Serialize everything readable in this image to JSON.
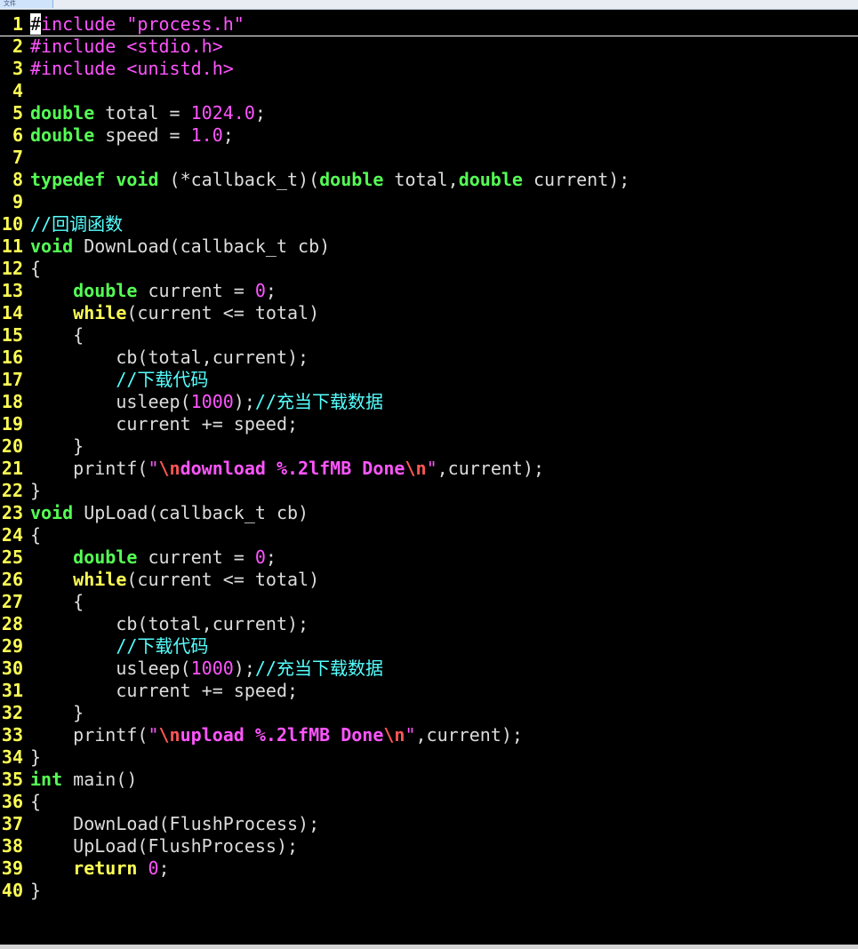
{
  "window": {
    "tab_label": "文件"
  },
  "editor": {
    "lines": [
      {
        "n": "1",
        "tokens": [
          {
            "t": "#",
            "c": "cursor"
          },
          {
            "t": "include ",
            "c": "pre"
          },
          {
            "t": "\"process.h\"",
            "c": "str"
          }
        ]
      },
      {
        "n": "2",
        "tokens": [
          {
            "t": "#include ",
            "c": "pre"
          },
          {
            "t": "<stdio.h>",
            "c": "str"
          }
        ]
      },
      {
        "n": "3",
        "tokens": [
          {
            "t": "#include ",
            "c": "pre"
          },
          {
            "t": "<unistd.h>",
            "c": "str"
          }
        ]
      },
      {
        "n": "4",
        "tokens": []
      },
      {
        "n": "5",
        "tokens": [
          {
            "t": "double",
            "c": "type"
          },
          {
            "t": " total = ",
            "c": "plain"
          },
          {
            "t": "1024.0",
            "c": "num"
          },
          {
            "t": ";",
            "c": "plain"
          }
        ]
      },
      {
        "n": "6",
        "tokens": [
          {
            "t": "double",
            "c": "type"
          },
          {
            "t": " speed = ",
            "c": "plain"
          },
          {
            "t": "1.0",
            "c": "num"
          },
          {
            "t": ";",
            "c": "plain"
          }
        ]
      },
      {
        "n": "7",
        "tokens": []
      },
      {
        "n": "8",
        "tokens": [
          {
            "t": "typedef",
            "c": "type"
          },
          {
            "t": " ",
            "c": "plain"
          },
          {
            "t": "void",
            "c": "type"
          },
          {
            "t": " (*callback_t)(",
            "c": "plain"
          },
          {
            "t": "double",
            "c": "type"
          },
          {
            "t": " total,",
            "c": "plain"
          },
          {
            "t": "double",
            "c": "type"
          },
          {
            "t": " current);",
            "c": "plain"
          }
        ]
      },
      {
        "n": "9",
        "tokens": []
      },
      {
        "n": "10",
        "tokens": [
          {
            "t": "//回调函数",
            "c": "cmt"
          }
        ]
      },
      {
        "n": "11",
        "tokens": [
          {
            "t": "void",
            "c": "type"
          },
          {
            "t": " DownLoad(callback_t cb)",
            "c": "plain"
          }
        ]
      },
      {
        "n": "12",
        "tokens": [
          {
            "t": "{",
            "c": "plain"
          }
        ]
      },
      {
        "n": "13",
        "tokens": [
          {
            "t": "    ",
            "c": "plain"
          },
          {
            "t": "double",
            "c": "type"
          },
          {
            "t": " current = ",
            "c": "plain"
          },
          {
            "t": "0",
            "c": "num"
          },
          {
            "t": ";",
            "c": "plain"
          }
        ]
      },
      {
        "n": "14",
        "tokens": [
          {
            "t": "    ",
            "c": "plain"
          },
          {
            "t": "while",
            "c": "stmt"
          },
          {
            "t": "(current <= total)",
            "c": "plain"
          }
        ]
      },
      {
        "n": "15",
        "tokens": [
          {
            "t": "    {",
            "c": "plain"
          }
        ]
      },
      {
        "n": "16",
        "tokens": [
          {
            "t": "        cb(total,current);",
            "c": "plain"
          }
        ]
      },
      {
        "n": "17",
        "tokens": [
          {
            "t": "        ",
            "c": "plain"
          },
          {
            "t": "//下载代码",
            "c": "cmt"
          }
        ]
      },
      {
        "n": "18",
        "tokens": [
          {
            "t": "        usleep(",
            "c": "plain"
          },
          {
            "t": "1000",
            "c": "num"
          },
          {
            "t": ");",
            "c": "plain"
          },
          {
            "t": "//充当下载数据",
            "c": "cmt"
          }
        ]
      },
      {
        "n": "19",
        "tokens": [
          {
            "t": "        current += speed;",
            "c": "plain"
          }
        ]
      },
      {
        "n": "20",
        "tokens": [
          {
            "t": "    }",
            "c": "plain"
          }
        ]
      },
      {
        "n": "21",
        "tokens": [
          {
            "t": "    printf(",
            "c": "plain"
          },
          {
            "t": "\"",
            "c": "str"
          },
          {
            "t": "\\n",
            "c": "esc"
          },
          {
            "t": "download %.2lfMB Done",
            "c": "strb"
          },
          {
            "t": "\\n",
            "c": "esc"
          },
          {
            "t": "\"",
            "c": "str"
          },
          {
            "t": ",current);",
            "c": "plain"
          }
        ]
      },
      {
        "n": "22",
        "tokens": [
          {
            "t": "}",
            "c": "plain"
          }
        ]
      },
      {
        "n": "23",
        "tokens": [
          {
            "t": "void",
            "c": "type"
          },
          {
            "t": " UpLoad(callback_t cb)",
            "c": "plain"
          }
        ]
      },
      {
        "n": "24",
        "tokens": [
          {
            "t": "{",
            "c": "plain"
          }
        ]
      },
      {
        "n": "25",
        "tokens": [
          {
            "t": "    ",
            "c": "plain"
          },
          {
            "t": "double",
            "c": "type"
          },
          {
            "t": " current = ",
            "c": "plain"
          },
          {
            "t": "0",
            "c": "num"
          },
          {
            "t": ";",
            "c": "plain"
          }
        ]
      },
      {
        "n": "26",
        "tokens": [
          {
            "t": "    ",
            "c": "plain"
          },
          {
            "t": "while",
            "c": "stmt"
          },
          {
            "t": "(current <= total)",
            "c": "plain"
          }
        ]
      },
      {
        "n": "27",
        "tokens": [
          {
            "t": "    {",
            "c": "plain"
          }
        ]
      },
      {
        "n": "28",
        "tokens": [
          {
            "t": "        cb(total,current);",
            "c": "plain"
          }
        ]
      },
      {
        "n": "29",
        "tokens": [
          {
            "t": "        ",
            "c": "plain"
          },
          {
            "t": "//下载代码",
            "c": "cmt"
          }
        ]
      },
      {
        "n": "30",
        "tokens": [
          {
            "t": "        usleep(",
            "c": "plain"
          },
          {
            "t": "1000",
            "c": "num"
          },
          {
            "t": ");",
            "c": "plain"
          },
          {
            "t": "//充当下载数据",
            "c": "cmt"
          }
        ]
      },
      {
        "n": "31",
        "tokens": [
          {
            "t": "        current += speed;",
            "c": "plain"
          }
        ]
      },
      {
        "n": "32",
        "tokens": [
          {
            "t": "    }",
            "c": "plain"
          }
        ]
      },
      {
        "n": "33",
        "tokens": [
          {
            "t": "    printf(",
            "c": "plain"
          },
          {
            "t": "\"",
            "c": "str"
          },
          {
            "t": "\\n",
            "c": "esc"
          },
          {
            "t": "upload %.2lfMB Done",
            "c": "strb"
          },
          {
            "t": "\\n",
            "c": "esc"
          },
          {
            "t": "\"",
            "c": "str"
          },
          {
            "t": ",current);",
            "c": "plain"
          }
        ]
      },
      {
        "n": "34",
        "tokens": [
          {
            "t": "}",
            "c": "plain"
          }
        ]
      },
      {
        "n": "35",
        "tokens": [
          {
            "t": "int",
            "c": "type"
          },
          {
            "t": " main()",
            "c": "plain"
          }
        ]
      },
      {
        "n": "36",
        "tokens": [
          {
            "t": "{",
            "c": "plain"
          }
        ]
      },
      {
        "n": "37",
        "tokens": [
          {
            "t": "    DownLoad(FlushProcess);",
            "c": "plain"
          }
        ]
      },
      {
        "n": "38",
        "tokens": [
          {
            "t": "    UpLoad(FlushProcess);",
            "c": "plain"
          }
        ]
      },
      {
        "n": "39",
        "tokens": [
          {
            "t": "    ",
            "c": "plain"
          },
          {
            "t": "return",
            "c": "stmt"
          },
          {
            "t": " ",
            "c": "plain"
          },
          {
            "t": "0",
            "c": "num"
          },
          {
            "t": ";",
            "c": "plain"
          }
        ]
      },
      {
        "n": "40",
        "tokens": [
          {
            "t": "}",
            "c": "plain"
          }
        ]
      }
    ]
  }
}
